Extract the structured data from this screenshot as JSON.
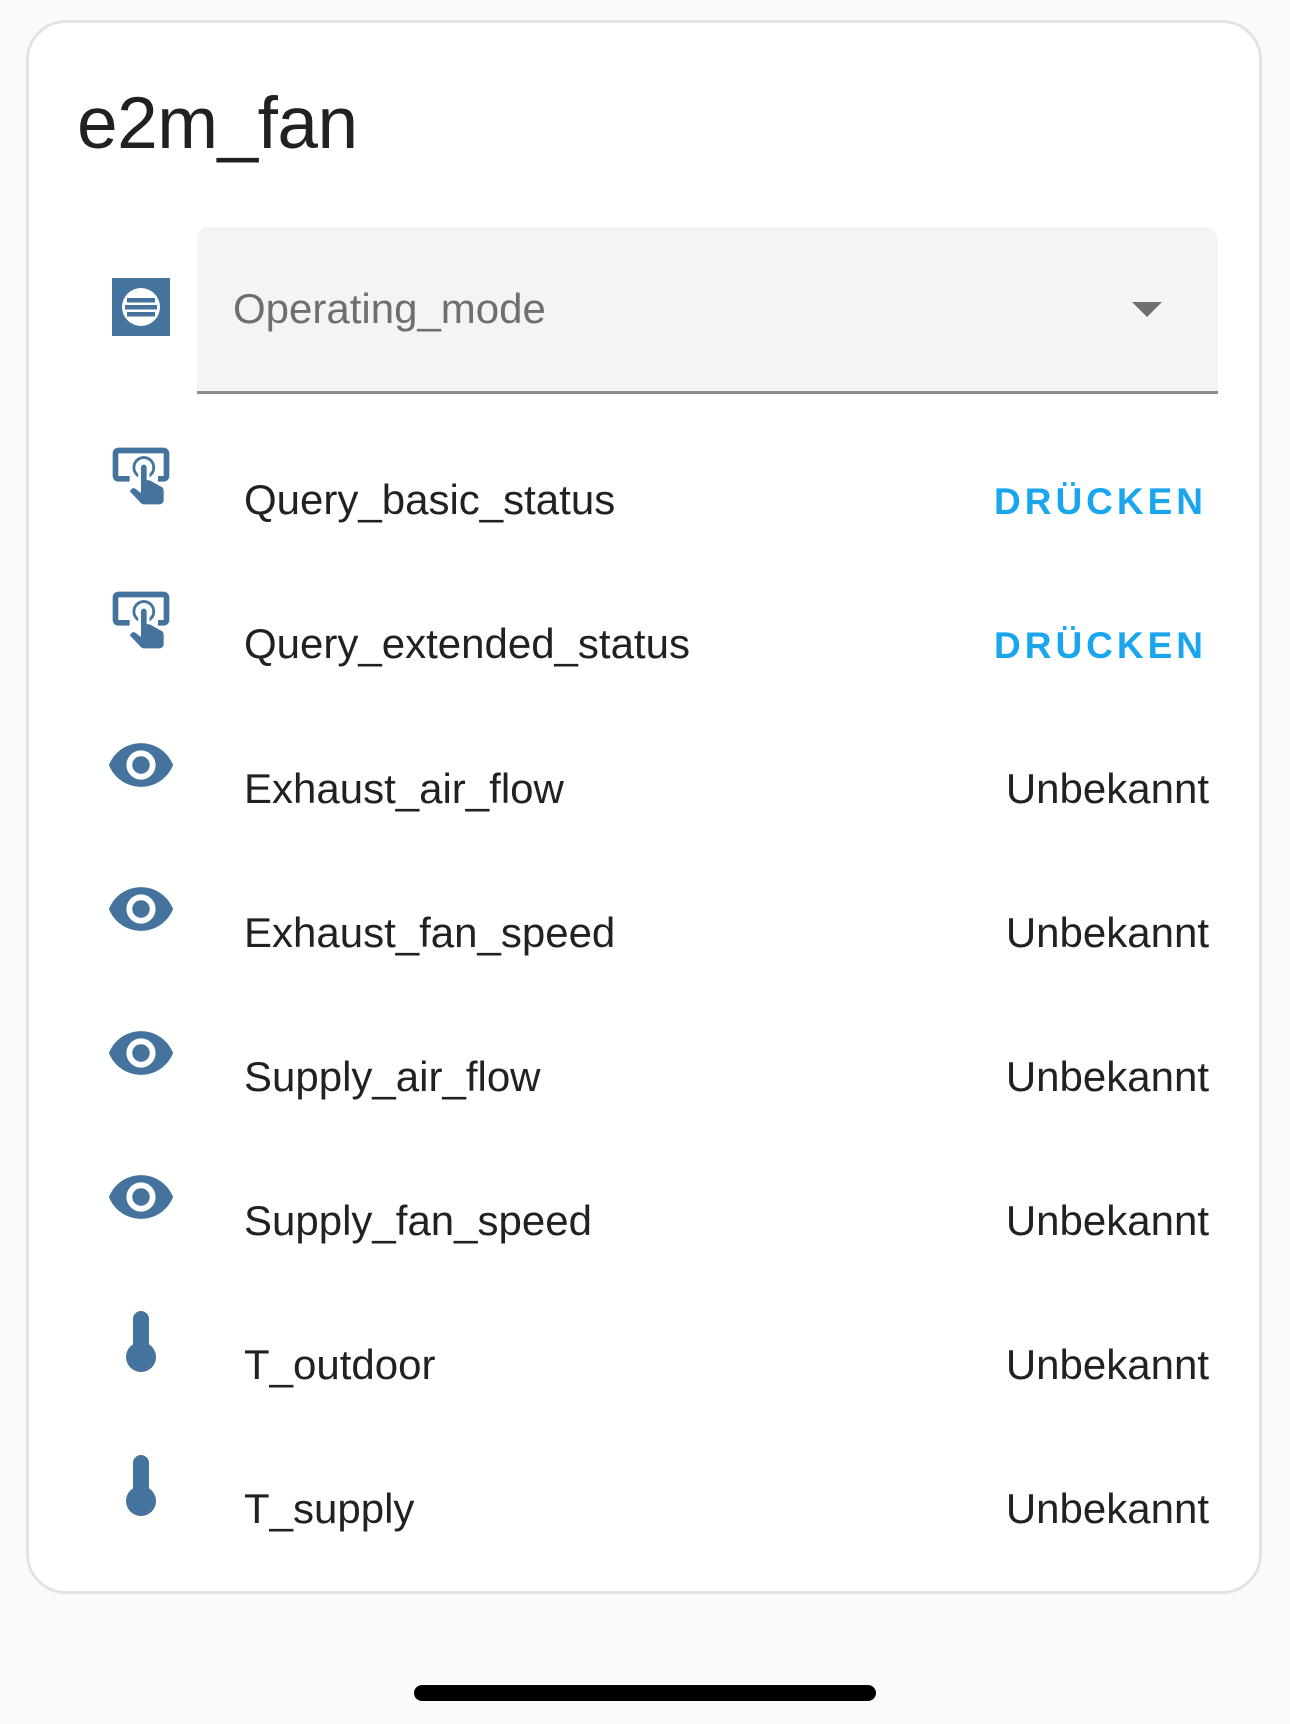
{
  "card": {
    "title": "e2m_fan"
  },
  "select": {
    "icon": "format-list-bulleted-circle-icon",
    "label": "Operating_mode"
  },
  "rows": [
    {
      "icon": "gesture-tap-button-icon",
      "label": "Query_basic_status",
      "action": "DRÜCKEN"
    },
    {
      "icon": "gesture-tap-button-icon",
      "label": "Query_extended_status",
      "action": "DRÜCKEN"
    },
    {
      "icon": "eye-icon",
      "label": "Exhaust_air_flow",
      "value": "Unbekannt"
    },
    {
      "icon": "eye-icon",
      "label": "Exhaust_fan_speed",
      "value": "Unbekannt"
    },
    {
      "icon": "eye-icon",
      "label": "Supply_air_flow",
      "value": "Unbekannt"
    },
    {
      "icon": "eye-icon",
      "label": "Supply_fan_speed",
      "value": "Unbekannt"
    },
    {
      "icon": "thermometer-icon",
      "label": "T_outdoor",
      "value": "Unbekannt"
    },
    {
      "icon": "thermometer-icon",
      "label": "T_supply",
      "value": "Unbekannt"
    }
  ],
  "colors": {
    "icon": "#44739e",
    "action": "#1aa6ee",
    "text": "#212121",
    "muted": "#6e6e6e"
  }
}
